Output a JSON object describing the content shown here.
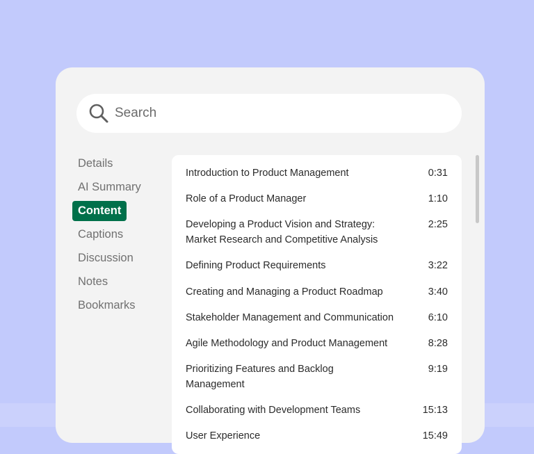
{
  "colors": {
    "background": "#c2cafc",
    "panel": "#f3f3f3",
    "accent": "#00704a"
  },
  "search": {
    "icon": "search-icon",
    "placeholder": "Search"
  },
  "nav": {
    "items": [
      {
        "label": "Details",
        "active": false
      },
      {
        "label": "AI Summary",
        "active": false
      },
      {
        "label": "Content",
        "active": true
      },
      {
        "label": "Captions",
        "active": false
      },
      {
        "label": "Discussion",
        "active": false
      },
      {
        "label": "Notes",
        "active": false
      },
      {
        "label": "Bookmarks",
        "active": false
      }
    ]
  },
  "content": {
    "items": [
      {
        "title": "Introduction to Product Management",
        "time": "0:31"
      },
      {
        "title": "Role of a Product Manager",
        "time": "1:10"
      },
      {
        "title": "Developing a Product Vision and Strategy: Market Research and Competitive Analysis",
        "time": "2:25"
      },
      {
        "title": "Defining Product Requirements",
        "time": "3:22"
      },
      {
        "title": "Creating and Managing a Product Roadmap",
        "time": "3:40"
      },
      {
        "title": "Stakeholder Management and Communication",
        "time": "6:10"
      },
      {
        "title": "Agile Methodology and Product Management",
        "time": "8:28"
      },
      {
        "title": "Prioritizing Features and Backlog Management",
        "time": "9:19"
      },
      {
        "title": "Collaborating with Development Teams",
        "time": "15:13"
      },
      {
        "title": "User Experience",
        "time": "15:49"
      }
    ]
  }
}
